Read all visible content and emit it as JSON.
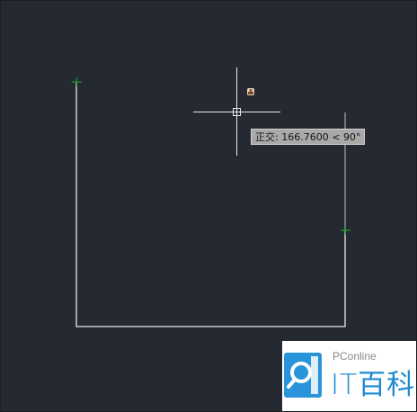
{
  "app": {
    "canvas_background": "#252a32",
    "line_color": "#ffffff",
    "grip_color": "#1f9b2a"
  },
  "dynamic_input": {
    "mode_label": "正交:",
    "value": "166.7600",
    "angle_separator": "<",
    "angle": "90°"
  },
  "watermark": {
    "brand": "PConline",
    "text": "IT百科",
    "logo_icon": "search-magnifier-logo",
    "accent_color": "#1f8ad3"
  }
}
